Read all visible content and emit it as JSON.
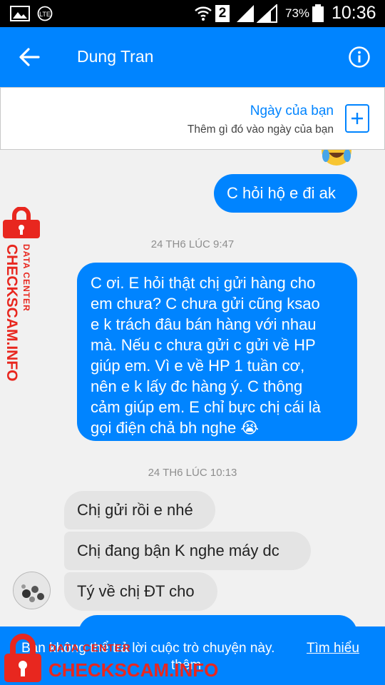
{
  "status_bar": {
    "sim_slot": "2",
    "battery_percent": "73%",
    "time": "10:36"
  },
  "header": {
    "contact_name": "Dung Tran"
  },
  "day_banner": {
    "title": "Ngày của bạn",
    "subtitle": "Thêm gì đó vào ngày của bạn"
  },
  "messages": [
    {
      "id": "m1",
      "direction": "outgoing",
      "text": "C hỏi hộ e đi ak"
    },
    {
      "id": "ts1",
      "type": "timestamp",
      "text": "24 TH6 LÚC 9:47"
    },
    {
      "id": "m2",
      "direction": "outgoing",
      "lines": [
        "C ơi. E hỏi thật chị gửi hàng cho",
        "em chưa? C chưa gửi cũng ksao",
        "e k trách đâu bán hàng với nhau",
        "mà. Nếu c chưa gửi c gửi về HP",
        "giúp em. Vì e về HP 1 tuần cơ,",
        "nên e k lấy đc hàng ý. C thông",
        "cảm giúp em. E chỉ bực chị cái là",
        "gọi điện chả bh nghe 😭"
      ]
    },
    {
      "id": "ts2",
      "type": "timestamp",
      "text": "24 TH6 LÚC 10:13"
    },
    {
      "id": "m3",
      "direction": "incoming",
      "text": "Chị gửi rồi e nhé"
    },
    {
      "id": "m4",
      "direction": "incoming",
      "text": "Chị đang bận K nghe máy dc"
    },
    {
      "id": "m5",
      "direction": "incoming",
      "text": "Tý về chị ĐT cho"
    }
  ],
  "notice": {
    "text": "Bạn không thể trả lời cuộc trò chuyện này.",
    "link": "Tìm hiểu",
    "link_cont": "thêm"
  },
  "watermark": {
    "top_label": "DATA CENTER",
    "site": "CHECKSCAM.INFO"
  },
  "colors": {
    "messenger_blue": "#0084ff",
    "incoming_bubble": "#e4e4e4",
    "chat_background": "#f1f1f1",
    "watermark_red": "#e8271f"
  },
  "icons": [
    "picture-icon",
    "lte-icon",
    "wifi-icon",
    "signal-icon",
    "battery-icon",
    "back-arrow-icon",
    "info-icon",
    "add-day-icon",
    "crying-emoji-icon",
    "avatar"
  ]
}
